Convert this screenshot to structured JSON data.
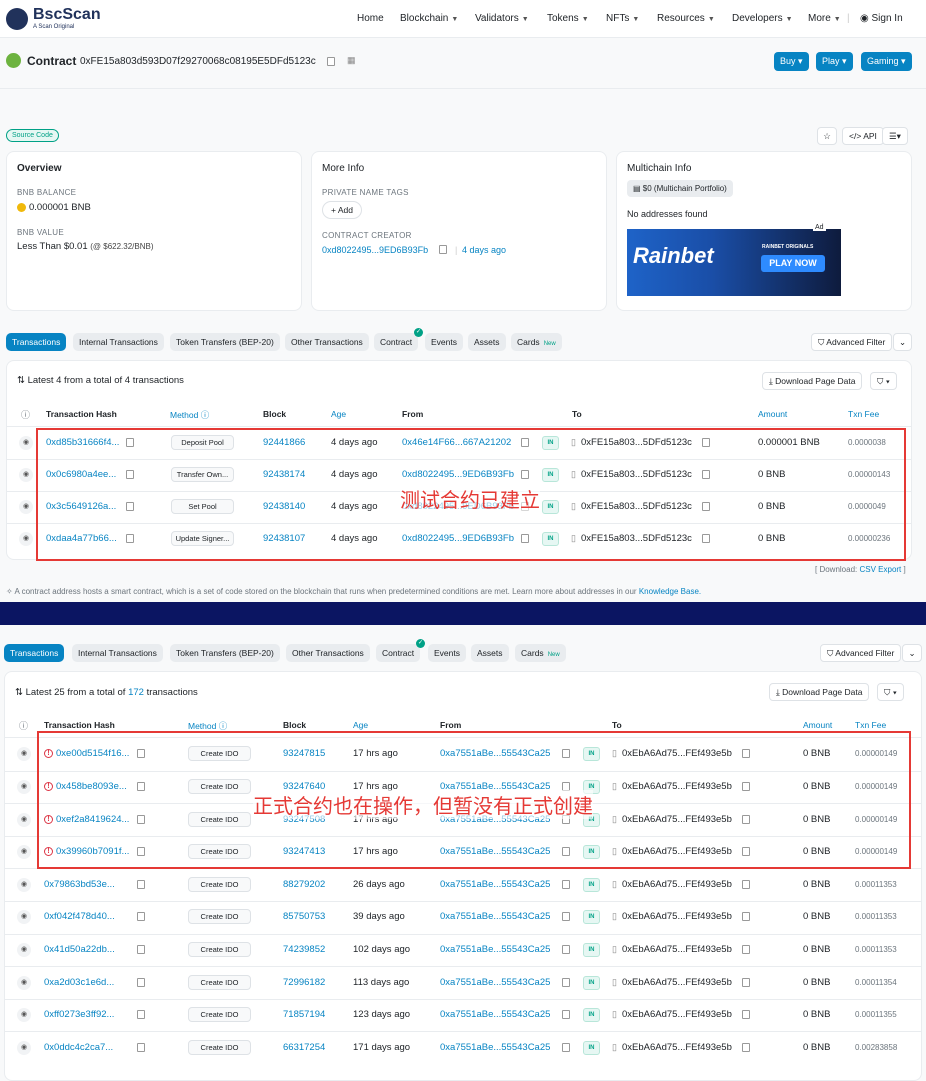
{
  "nav": {
    "logo": "BscScan",
    "logo_sub": "A Scan Original",
    "items": [
      "Home",
      "Blockchain",
      "Validators",
      "Tokens",
      "NFTs",
      "Resources",
      "Developers",
      "More"
    ],
    "signin": "Sign In"
  },
  "contract": {
    "label": "Contract",
    "address": "0xFE15a803d593D07f29270068c08195E5DFd5123c",
    "buttons": [
      "Buy",
      "Play",
      "Gaming"
    ]
  },
  "source_code": "Source Code",
  "toolbar": {
    "api": "API"
  },
  "overview": {
    "title": "Overview",
    "bnb_balance_label": "BNB BALANCE",
    "bnb_balance": "0.000001 BNB",
    "bnb_value_label": "BNB VALUE",
    "bnb_value": "Less Than $0.01",
    "bnb_value_rate": "(@ $622.32/BNB)"
  },
  "more_info": {
    "title": "More Info",
    "private_tags_label": "PRIVATE NAME TAGS",
    "add": "+ Add",
    "creator_label": "CONTRACT CREATOR",
    "creator": "0xd8022495...9ED6B93Fb",
    "creator_sep": "|",
    "creator_age": "4 days ago"
  },
  "multichain": {
    "title": "Multichain Info",
    "portfolio": "$0 (Multichain Portfolio)",
    "no_addr": "No addresses found",
    "ad": "Ad",
    "ad_brand": "Rainbet",
    "ad_tag": "RAINBET ORIGINALS",
    "ad_cta": "PLAY NOW"
  },
  "tabs": [
    "Transactions",
    "Internal Transactions",
    "Token Transfers (BEP-20)",
    "Other Transactions",
    "Contract",
    "Events",
    "Assets",
    "Cards"
  ],
  "tabs_new": "New",
  "advanced_filter": "Advanced Filter",
  "download_page": "Download Page Data",
  "headers": {
    "hash": "Transaction Hash",
    "method": "Method",
    "block": "Block",
    "age": "Age",
    "from": "From",
    "to": "To",
    "amount": "Amount",
    "fee": "Txn Fee"
  },
  "in": "IN",
  "table1": {
    "summary": "Latest 4 from a total of 4 transactions",
    "rows": [
      {
        "hash": "0xd85b31666f4...",
        "method": "Deposit Pool",
        "block": "92441866",
        "age": "4 days ago",
        "from": "0x46e14F66...667A21202",
        "to": "0xFE15a803...5DFd5123c",
        "amount": "0.000001 BNB",
        "fee": "0.0000038"
      },
      {
        "hash": "0x0c6980a4ee...",
        "method": "Transfer Own...",
        "block": "92438174",
        "age": "4 days ago",
        "from": "0xd8022495...9ED6B93Fb",
        "to": "0xFE15a803...5DFd5123c",
        "amount": "0 BNB",
        "fee": "0.00000143"
      },
      {
        "hash": "0x3c5649126a...",
        "method": "Set Pool",
        "block": "92438140",
        "age": "4 days ago",
        "from": "0xd8022495...9ED6B93Fb",
        "to": "0xFE15a803...5DFd5123c",
        "amount": "0 BNB",
        "fee": "0.0000049"
      },
      {
        "hash": "0xdaa4a77b66...",
        "method": "Update Signer...",
        "block": "92438107",
        "age": "4 days ago",
        "from": "0xd8022495...9ED6B93Fb",
        "to": "0xFE15a803...5DFd5123c",
        "amount": "0 BNB",
        "fee": "0.00000236"
      }
    ],
    "annotation": "测试合约已建立",
    "csv_pre": "[ Download:",
    "csv": "CSV Export",
    "csv_post": "]"
  },
  "note": "A contract address hosts a smart contract, which is a set of code stored on the blockchain that runs when predetermined conditions are met. Learn more about addresses in our",
  "note_link": "Knowledge Base.",
  "table2": {
    "summary_pre": "Latest 25 from a total of",
    "summary_count": "172",
    "summary_post": "transactions",
    "rows": [
      {
        "hash": "0xe00d5154f16...",
        "err": true,
        "method": "Create IDO",
        "block": "93247815",
        "age": "17 hrs ago",
        "from": "0xa7551aBe...55543Ca25",
        "to": "0xEbA6Ad75...FEf493e5b",
        "amount": "0 BNB",
        "fee": "0.00000149"
      },
      {
        "hash": "0x458be8093e...",
        "err": true,
        "method": "Create IDO",
        "block": "93247640",
        "age": "17 hrs ago",
        "from": "0xa7551aBe...55543Ca25",
        "to": "0xEbA6Ad75...FEf493e5b",
        "amount": "0 BNB",
        "fee": "0.00000149"
      },
      {
        "hash": "0xef2a8419624...",
        "err": true,
        "method": "Create IDO",
        "block": "93247508",
        "age": "17 hrs ago",
        "from": "0xa7551aBe...55543Ca25",
        "to": "0xEbA6Ad75...FEf493e5b",
        "amount": "0 BNB",
        "fee": "0.00000149"
      },
      {
        "hash": "0x39960b7091f...",
        "err": true,
        "method": "Create IDO",
        "block": "93247413",
        "age": "17 hrs ago",
        "from": "0xa7551aBe...55543Ca25",
        "to": "0xEbA6Ad75...FEf493e5b",
        "amount": "0 BNB",
        "fee": "0.00000149"
      },
      {
        "hash": "0x79863bd53e...",
        "err": false,
        "method": "Create IDO",
        "block": "88279202",
        "age": "26 days ago",
        "from": "0xa7551aBe...55543Ca25",
        "to": "0xEbA6Ad75...FEf493e5b",
        "amount": "0 BNB",
        "fee": "0.00011353"
      },
      {
        "hash": "0xf042f478d40...",
        "err": false,
        "method": "Create IDO",
        "block": "85750753",
        "age": "39 days ago",
        "from": "0xa7551aBe...55543Ca25",
        "to": "0xEbA6Ad75...FEf493e5b",
        "amount": "0 BNB",
        "fee": "0.00011353"
      },
      {
        "hash": "0x41d50a22db...",
        "err": false,
        "method": "Create IDO",
        "block": "74239852",
        "age": "102 days ago",
        "from": "0xa7551aBe...55543Ca25",
        "to": "0xEbA6Ad75...FEf493e5b",
        "amount": "0 BNB",
        "fee": "0.00011353"
      },
      {
        "hash": "0xa2d03c1e6d...",
        "err": false,
        "method": "Create IDO",
        "block": "72996182",
        "age": "113 days ago",
        "from": "0xa7551aBe...55543Ca25",
        "to": "0xEbA6Ad75...FEf493e5b",
        "amount": "0 BNB",
        "fee": "0.00011354"
      },
      {
        "hash": "0xff0273e3ff92...",
        "err": false,
        "method": "Create IDO",
        "block": "71857194",
        "age": "123 days ago",
        "from": "0xa7551aBe...55543Ca25",
        "to": "0xEbA6Ad75...FEf493e5b",
        "amount": "0 BNB",
        "fee": "0.00011355"
      },
      {
        "hash": "0x0ddc4c2ca7...",
        "err": false,
        "method": "Create IDO",
        "block": "66317254",
        "age": "171 days ago",
        "from": "0xa7551aBe...55543Ca25",
        "to": "0xEbA6Ad75...FEf493e5b",
        "amount": "0 BNB",
        "fee": "0.00283858"
      }
    ],
    "annotation": "正式合约也在操作，但暂没有正式创建"
  },
  "colors": {
    "accent": "#0784c3",
    "brand": "#21325b",
    "divider": "#0b1562",
    "annotation": "#e53935",
    "in_green": "#00a186"
  }
}
